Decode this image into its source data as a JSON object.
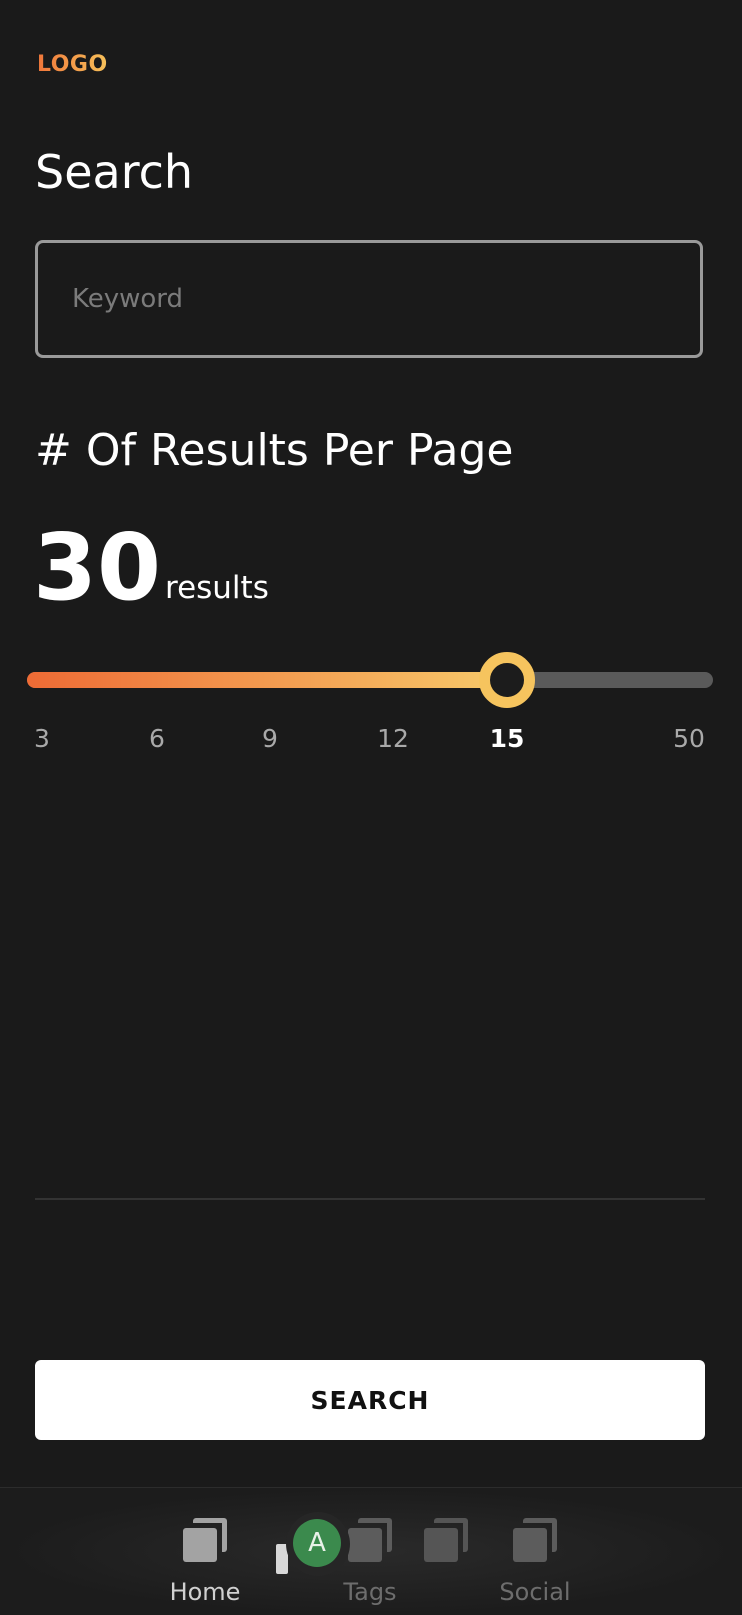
{
  "header": {
    "logo_text": "LOGO"
  },
  "search": {
    "title": "Search",
    "keyword_placeholder": "Keyword",
    "keyword_value": ""
  },
  "results_per_page": {
    "heading": "# Of Results Per Page",
    "value": "30",
    "unit": "results",
    "slider": {
      "ticks": [
        "3",
        "6",
        "9",
        "12",
        "15",
        "50"
      ],
      "selected_tick": "15",
      "fill_fraction": 0.7
    }
  },
  "actions": {
    "search_label": "SEARCH"
  },
  "bottom_nav": {
    "items": [
      {
        "label": "Home",
        "icon": "stack-icon",
        "active": true
      },
      {
        "label": "Tags",
        "icon": "stack-icon",
        "active": false
      },
      {
        "label": "Social",
        "icon": "stack-icon",
        "active": false
      }
    ],
    "avatar_initial": "A"
  },
  "colors": {
    "background": "#1a1a1a",
    "accent_start": "#ee6b35",
    "accent_end": "#f7c96a",
    "avatar": "#3b8a4d"
  }
}
